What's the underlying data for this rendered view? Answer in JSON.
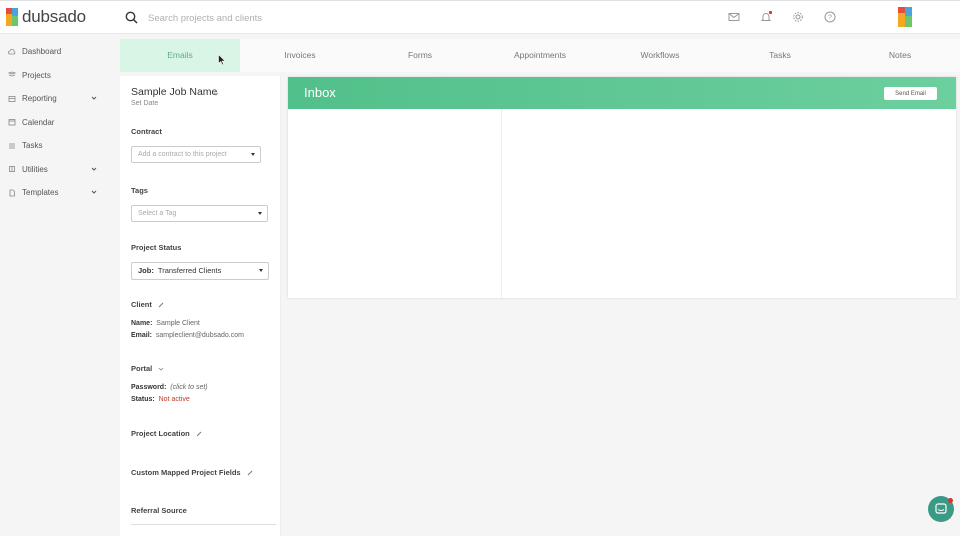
{
  "app": {
    "logo_text": "dubsado"
  },
  "search": {
    "placeholder": "Search projects and clients"
  },
  "sidebar": {
    "items": [
      {
        "label": "Dashboard",
        "icon": "cloud-icon"
      },
      {
        "label": "Projects",
        "icon": "projects-icon"
      },
      {
        "label": "Reporting",
        "icon": "reporting-icon",
        "has_chevron": true
      },
      {
        "label": "Calendar",
        "icon": "calendar-icon"
      },
      {
        "label": "Tasks",
        "icon": "tasks-icon"
      },
      {
        "label": "Utilities",
        "icon": "utilities-icon",
        "has_chevron": true
      },
      {
        "label": "Templates",
        "icon": "templates-icon",
        "has_chevron": true
      }
    ]
  },
  "tabs": [
    "Emails",
    "Invoices",
    "Forms",
    "Appointments",
    "Workflows",
    "Tasks",
    "Notes"
  ],
  "active_tab": "Emails",
  "project": {
    "name": "Sample Job Name",
    "set_date": "Set Date",
    "contract_title": "Contract",
    "contract_placeholder": "Add a contract to this project",
    "tags_title": "Tags",
    "tags_placeholder": "Select a Tag",
    "status_title": "Project Status",
    "status_prefix": "Job:",
    "status_value": "Transferred Clients",
    "client_title": "Client",
    "client_name_label": "Name:",
    "client_name": "Sample Client",
    "client_email_label": "Email:",
    "client_email": "sampleclient@dubsado.com",
    "portal_title": "Portal",
    "password_label": "Password:",
    "password_value": "(click to set)",
    "status_label": "Status:",
    "portal_status": "Not active",
    "location_title": "Project Location",
    "custom_fields_title": "Custom Mapped Project Fields",
    "referral_title": "Referral Source"
  },
  "inbox": {
    "title": "Inbox",
    "send_label": "Send Email"
  },
  "colors": {
    "accent": "#5cc592",
    "active_tab_bg": "#d8f5e5",
    "danger": "#c0392b"
  }
}
